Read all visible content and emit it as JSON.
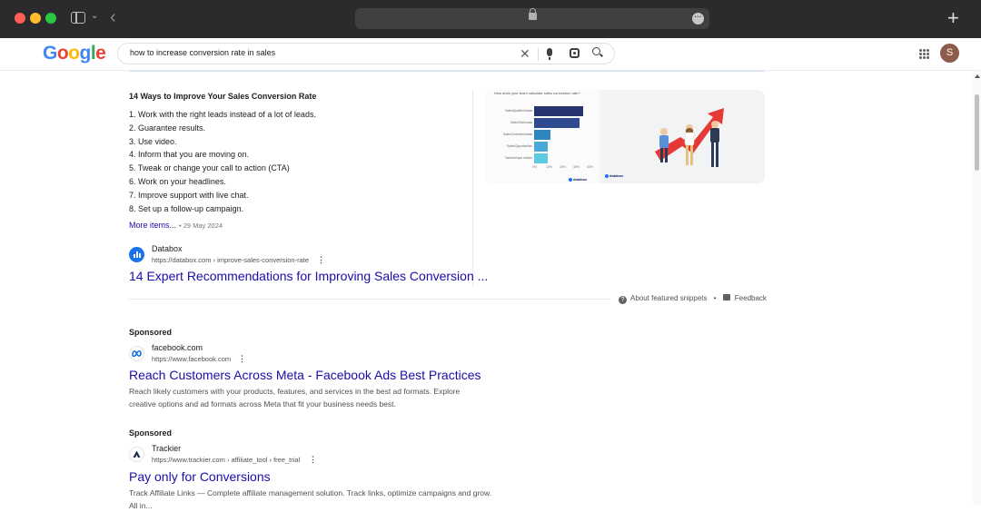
{
  "browser": {
    "new_tab_label": "+"
  },
  "google": {
    "logo_letters": [
      {
        "ch": "G",
        "color": "#4285f4"
      },
      {
        "ch": "o",
        "color": "#ea4335"
      },
      {
        "ch": "o",
        "color": "#fbbc05"
      },
      {
        "ch": "g",
        "color": "#4285f4"
      },
      {
        "ch": "l",
        "color": "#34a853"
      },
      {
        "ch": "e",
        "color": "#ea4335"
      }
    ],
    "search_query": "how to increase conversion rate in sales",
    "avatar_letter": "S"
  },
  "featured_snippet": {
    "title": "14 Ways to Improve Your Sales Conversion Rate",
    "items": [
      "1. Work with the right leads instead of a lot of leads.",
      "2. Guarantee results.",
      "3. Use video.",
      "4. Inform that you are moving on.",
      "5. Tweak or change your call to action (CTA)",
      "6. Work on your headlines.",
      "7. Improve support with live chat.",
      "8. Set up a follow-up campaign."
    ],
    "more_items": "More items...",
    "date": "• 29 May 2024",
    "source_name": "Databox",
    "source_url": "https://databox.com › improve-sales-conversion-rate",
    "link_title": "14 Expert Recommendations for Improving Sales Conversion ...",
    "about_label": "About featured snippets",
    "separator": "•",
    "feedback_label": "Feedback",
    "image_chart": {
      "title": "How does your team calculate sales conversion rate?",
      "bars": [
        {
          "label": "Sales/Qualified leads",
          "value": 36,
          "color": "#28346e"
        },
        {
          "label": "Sales/Total leads",
          "value": 33,
          "color": "#2f4a8f"
        },
        {
          "label": "Sales/Converted leads",
          "value": 12,
          "color": "#2e86c1"
        },
        {
          "label": "Sales/Opportunities",
          "value": 10,
          "color": "#48a9d6"
        },
        {
          "label": "Sales/Unique visitors",
          "value": 10,
          "color": "#5ccbe0"
        }
      ],
      "ticks": [
        "0%",
        "10%",
        "20%",
        "30%",
        "40%"
      ],
      "brand": "databox"
    },
    "image_right_brand": "databox"
  },
  "ads": [
    {
      "label": "Sponsored",
      "name": "facebook.com",
      "url": "https://www.facebook.com",
      "title": "Reach Customers Across Meta - Facebook Ads Best Practices",
      "snippet": "Reach likely customers with your products, features, and services in the best ad formats. Explore creative options and ad formats across Meta that fit your business needs best."
    },
    {
      "label": "Sponsored",
      "name": "Trackier",
      "url": "https://www.trackier.com › affiliate_tool › free_trial",
      "title": "Pay only for Conversions",
      "snippet": "Track Affiliate Links — Complete affiliate management solution. Track links, optimize campaigns and grow. All in..."
    }
  ]
}
